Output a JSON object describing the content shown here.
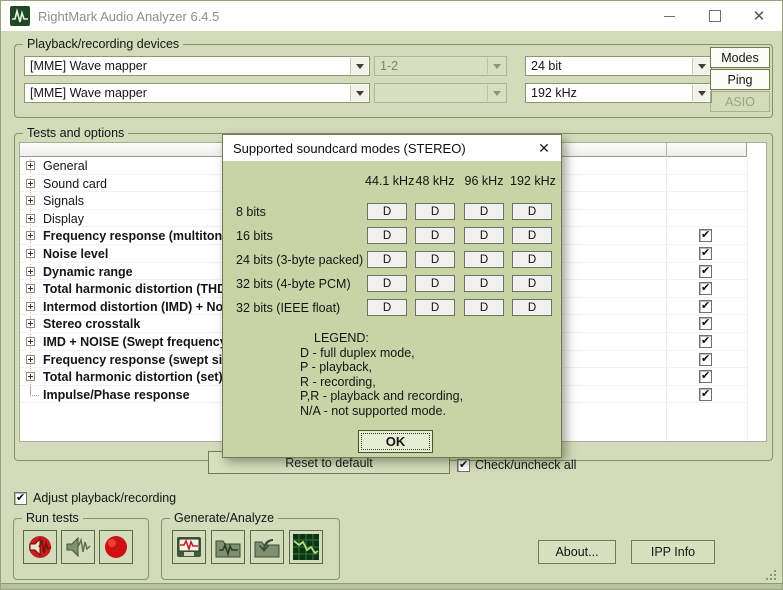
{
  "window": {
    "title": "RightMark Audio Analyzer 6.4.5"
  },
  "colors": {
    "window_bg": "#d3dcba",
    "dialog_bg": "#c9d4a6",
    "record_red": "#c41414"
  },
  "devices": {
    "group_label": "Playback/recording devices",
    "playback_device": "[MME] Wave mapper",
    "recording_device": "[MME] Wave mapper",
    "playback_channels": "1-2",
    "recording_channels": "",
    "bit_depth": "24 bit",
    "sample_rate": "192 kHz",
    "modes_label": "Modes",
    "ping_label": "Ping",
    "asio_label": "ASIO"
  },
  "tests": {
    "group_label": "Tests and options",
    "items": [
      {
        "label": "General",
        "bold": false,
        "expandable": true,
        "checked": null
      },
      {
        "label": "Sound card",
        "bold": false,
        "expandable": true,
        "checked": null
      },
      {
        "label": "Signals",
        "bold": false,
        "expandable": true,
        "checked": null
      },
      {
        "label": "Display",
        "bold": false,
        "expandable": true,
        "checked": null
      },
      {
        "label": "Frequency response (multitone)",
        "bold": true,
        "expandable": true,
        "checked": true
      },
      {
        "label": "Noise level",
        "bold": true,
        "expandable": true,
        "checked": true
      },
      {
        "label": "Dynamic range",
        "bold": true,
        "expandable": true,
        "checked": true
      },
      {
        "label": "Total harmonic distortion (THD)",
        "bold": true,
        "expandable": true,
        "checked": true
      },
      {
        "label": "Intermod distortion (IMD) + Noise",
        "bold": true,
        "expandable": true,
        "checked": true
      },
      {
        "label": "Stereo crosstalk",
        "bold": true,
        "expandable": true,
        "checked": true
      },
      {
        "label": "IMD + NOISE (Swept frequency)",
        "bold": true,
        "expandable": true,
        "checked": true
      },
      {
        "label": "Frequency response (swept sine)",
        "bold": true,
        "expandable": true,
        "checked": true
      },
      {
        "label": "Total harmonic distortion (set)",
        "bold": true,
        "expandable": true,
        "checked": true
      },
      {
        "label": "Impulse/Phase response",
        "bold": true,
        "expandable": false,
        "checked": true
      }
    ],
    "reset_button_label": "Reset to default",
    "check_all_label": "Check/uncheck all"
  },
  "dialog": {
    "title": "Supported soundcard modes (STEREO)",
    "columns": [
      "44.1 kHz",
      "48 kHz",
      "96 kHz",
      "192 kHz"
    ],
    "rows": [
      {
        "label": "8 bits",
        "values": [
          "D",
          "D",
          "D",
          "D"
        ]
      },
      {
        "label": "16 bits",
        "values": [
          "D",
          "D",
          "D",
          "D"
        ]
      },
      {
        "label": "24 bits (3-byte packed)",
        "values": [
          "D",
          "D",
          "D",
          "D"
        ]
      },
      {
        "label": "32 bits (4-byte PCM)",
        "values": [
          "D",
          "D",
          "D",
          "D"
        ]
      },
      {
        "label": "32 bits (IEEE float)",
        "values": [
          "D",
          "D",
          "D",
          "D"
        ]
      }
    ],
    "legend": [
      "LEGEND:",
      "D - full duplex mode,",
      "P - playback,",
      "R - recording,",
      "P,R - playback and recording,",
      "N/A - not supported mode."
    ],
    "ok_label": "OK"
  },
  "bottom": {
    "adjust_label": "Adjust playback/recording",
    "run_tests_label": "Run tests",
    "generate_label": "Generate/Analyze",
    "about_label": "About...",
    "ipp_label": "IPP Info"
  }
}
